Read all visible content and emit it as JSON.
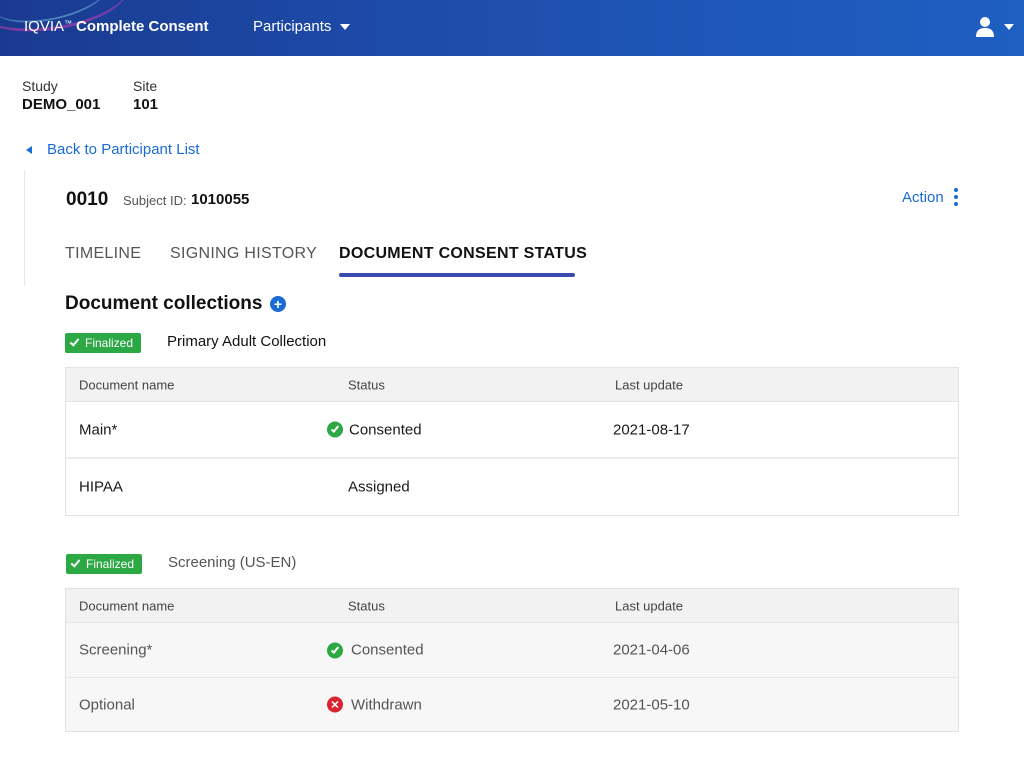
{
  "header": {
    "brand_prefix": "IQVIA",
    "brand_tm": "™",
    "brand_name": "Complete Consent",
    "nav_label": "Participants",
    "user_icon": "user-icon"
  },
  "study": {
    "label": "Study",
    "value": "DEMO_001"
  },
  "site": {
    "label": "Site",
    "value": "101"
  },
  "back_link": "Back to Participant List",
  "participant": {
    "number": "0010",
    "subject_label": "Subject ID:",
    "subject_value": "1010055",
    "action_label": "Action"
  },
  "tabs": [
    {
      "label": "TIMELINE",
      "active": false
    },
    {
      "label": "SIGNING HISTORY",
      "active": false
    },
    {
      "label": "DOCUMENT CONSENT STATUS",
      "active": true
    }
  ],
  "section_title": "Document collections",
  "columns": {
    "name": "Document name",
    "status": "Status",
    "updated": "Last update"
  },
  "collections": [
    {
      "badge": "Finalized",
      "name": "Primary Adult Collection",
      "rows": [
        {
          "name": "Main*",
          "status": "Consented",
          "status_icon": "check-circle-icon",
          "updated": "2021-08-17"
        },
        {
          "name": "HIPAA",
          "status": "Assigned",
          "status_icon": "",
          "updated": ""
        }
      ]
    },
    {
      "badge": "Finalized",
      "name": "Screening (US-EN)",
      "rows": [
        {
          "name": "Screening*",
          "status": "Consented",
          "status_icon": "check-circle-icon",
          "updated": "2021-04-06"
        },
        {
          "name": "Optional",
          "status": "Withdrawn",
          "status_icon": "x-circle-icon",
          "updated": "2021-05-10"
        }
      ]
    }
  ],
  "colors": {
    "accent": "#1a6bd6",
    "success": "#2ca844",
    "danger": "#d9232e",
    "tab_indicator": "#3a4bb0"
  }
}
